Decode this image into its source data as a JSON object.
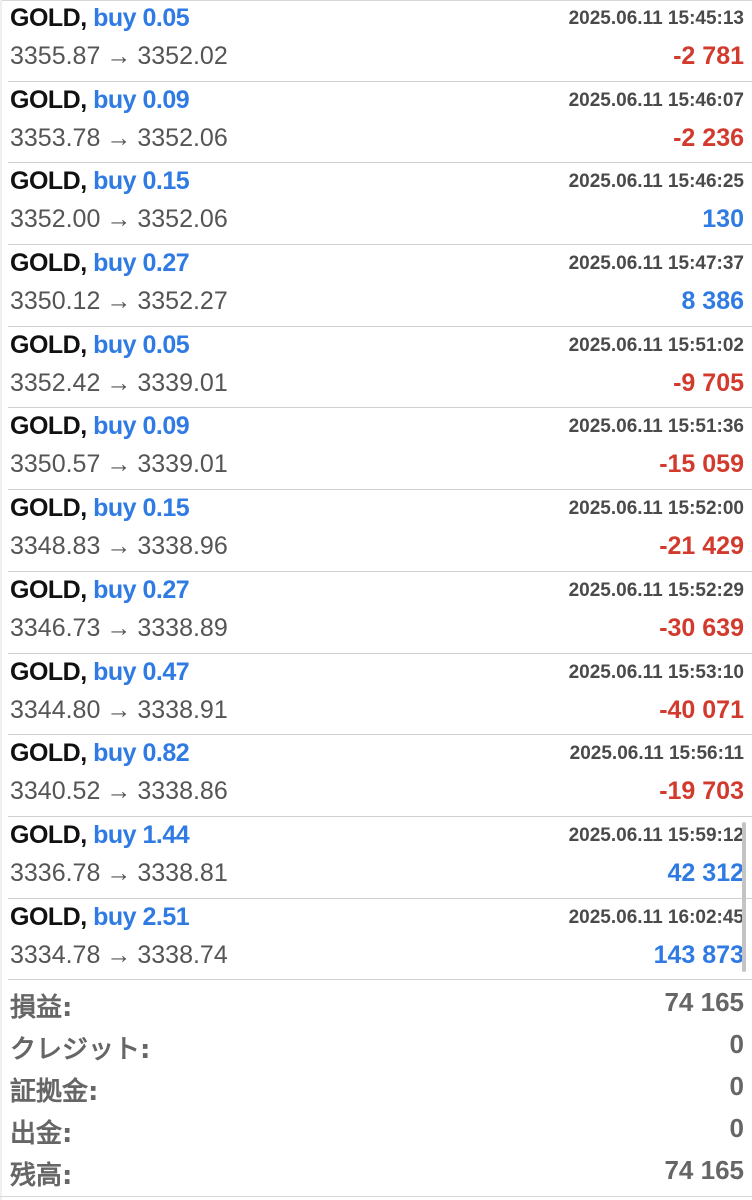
{
  "trades": [
    {
      "symbol": "GOLD,",
      "side": "buy 0.05",
      "time": "2025.06.11 15:45:13",
      "open": "3355.87",
      "close": "3352.02",
      "profit": "-2 781",
      "profit_positive": false
    },
    {
      "symbol": "GOLD,",
      "side": "buy 0.09",
      "time": "2025.06.11 15:46:07",
      "open": "3353.78",
      "close": "3352.06",
      "profit": "-2 236",
      "profit_positive": false
    },
    {
      "symbol": "GOLD,",
      "side": "buy 0.15",
      "time": "2025.06.11 15:46:25",
      "open": "3352.00",
      "close": "3352.06",
      "profit": "130",
      "profit_positive": true
    },
    {
      "symbol": "GOLD,",
      "side": "buy 0.27",
      "time": "2025.06.11 15:47:37",
      "open": "3350.12",
      "close": "3352.27",
      "profit": "8 386",
      "profit_positive": true
    },
    {
      "symbol": "GOLD,",
      "side": "buy 0.05",
      "time": "2025.06.11 15:51:02",
      "open": "3352.42",
      "close": "3339.01",
      "profit": "-9 705",
      "profit_positive": false
    },
    {
      "symbol": "GOLD,",
      "side": "buy 0.09",
      "time": "2025.06.11 15:51:36",
      "open": "3350.57",
      "close": "3339.01",
      "profit": "-15 059",
      "profit_positive": false
    },
    {
      "symbol": "GOLD,",
      "side": "buy 0.15",
      "time": "2025.06.11 15:52:00",
      "open": "3348.83",
      "close": "3338.96",
      "profit": "-21 429",
      "profit_positive": false
    },
    {
      "symbol": "GOLD,",
      "side": "buy 0.27",
      "time": "2025.06.11 15:52:29",
      "open": "3346.73",
      "close": "3338.89",
      "profit": "-30 639",
      "profit_positive": false
    },
    {
      "symbol": "GOLD,",
      "side": "buy 0.47",
      "time": "2025.06.11 15:53:10",
      "open": "3344.80",
      "close": "3338.91",
      "profit": "-40 071",
      "profit_positive": false
    },
    {
      "symbol": "GOLD,",
      "side": "buy 0.82",
      "time": "2025.06.11 15:56:11",
      "open": "3340.52",
      "close": "3338.86",
      "profit": "-19 703",
      "profit_positive": false
    },
    {
      "symbol": "GOLD,",
      "side": "buy 1.44",
      "time": "2025.06.11 15:59:12",
      "open": "3336.78",
      "close": "3338.81",
      "profit": "42 312",
      "profit_positive": true
    },
    {
      "symbol": "GOLD,",
      "side": "buy 2.51",
      "time": "2025.06.11 16:02:45",
      "open": "3334.78",
      "close": "3338.74",
      "profit": "143 873",
      "profit_positive": true
    }
  ],
  "arrow": "→",
  "summary": {
    "profit_label": "損益:",
    "profit_value": "74 165",
    "credit_label": "クレジット:",
    "credit_value": "0",
    "margin_label": "証拠金:",
    "margin_value": "0",
    "withdrawal_label": "出金:",
    "withdrawal_value": "0",
    "balance_label": "残高:",
    "balance_value": "74 165"
  },
  "colors": {
    "buy_blue": "#2f7be3",
    "loss_red": "#d23a2e",
    "summary_gray": "#666666"
  }
}
